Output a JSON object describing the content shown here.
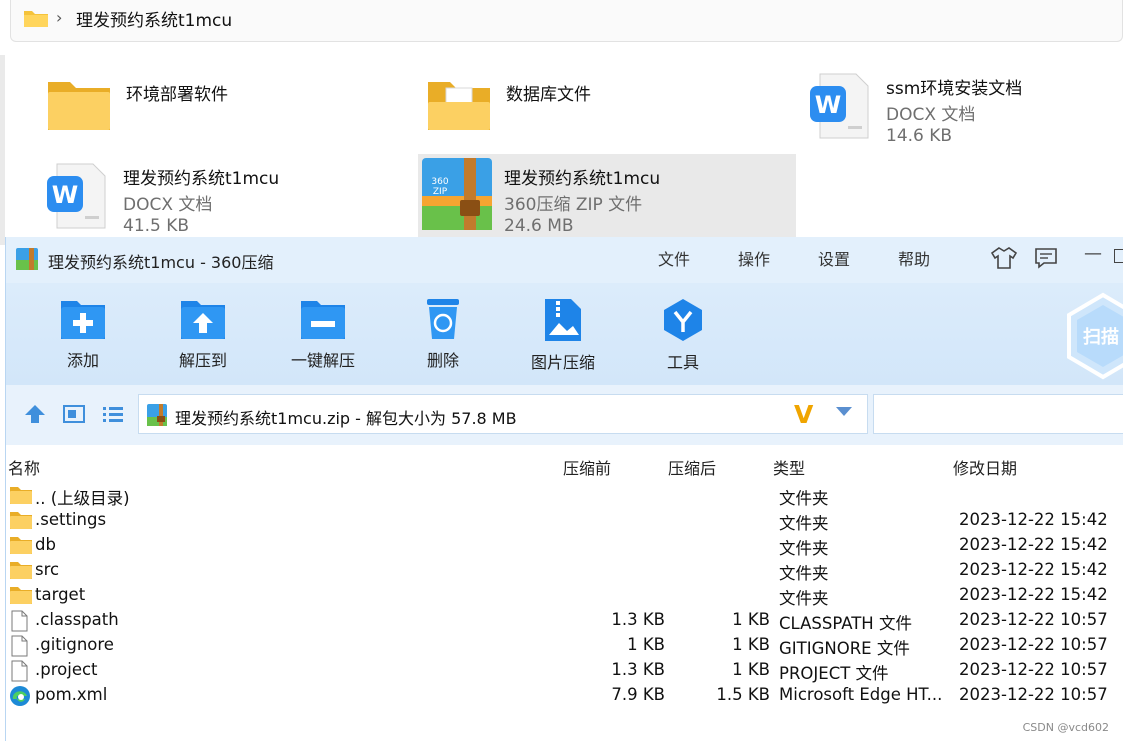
{
  "explorer": {
    "breadcrumb": "理发预约系统t1mcu",
    "items": [
      {
        "name": "环境部署软件",
        "type": "",
        "size": "",
        "icon": "folder-icon"
      },
      {
        "name": "数据库文件",
        "type": "",
        "size": "",
        "icon": "folder-with-document-icon"
      },
      {
        "name": "ssm环境安装文档",
        "type": "DOCX 文档",
        "size": "14.6 KB",
        "icon": "wps-document-icon"
      },
      {
        "name": "理发预约系统t1mcu",
        "type": "DOCX 文档",
        "size": "41.5 KB",
        "icon": "wps-document-icon"
      },
      {
        "name": "理发预约系统t1mcu",
        "type": "360压缩 ZIP 文件",
        "size": "24.6 MB",
        "icon": "zip-archive-icon"
      }
    ]
  },
  "window": {
    "title": "理发预约系统t1mcu - 360压缩",
    "menu": [
      "文件",
      "操作",
      "设置",
      "帮助"
    ],
    "toolbar": [
      "添加",
      "解压到",
      "一键解压",
      "删除",
      "图片压缩",
      "工具"
    ],
    "scan_label": "扫描",
    "address": "理发预约系统t1mcu.zip - 解包大小为 57.8 MB",
    "columns": {
      "name": "名称",
      "before": "压缩前",
      "after": "压缩后",
      "type": "类型",
      "date": "修改日期"
    },
    "rows": [
      {
        "name": ".. (上级目录)",
        "before": "",
        "after": "",
        "type": "文件夹",
        "date": "",
        "icon": "folder-icon"
      },
      {
        "name": ".settings",
        "before": "",
        "after": "",
        "type": "文件夹",
        "date": "2023-12-22 15:42",
        "icon": "folder-icon"
      },
      {
        "name": "db",
        "before": "",
        "after": "",
        "type": "文件夹",
        "date": "2023-12-22 15:42",
        "icon": "folder-icon"
      },
      {
        "name": "src",
        "before": "",
        "after": "",
        "type": "文件夹",
        "date": "2023-12-22 15:42",
        "icon": "folder-icon"
      },
      {
        "name": "target",
        "before": "",
        "after": "",
        "type": "文件夹",
        "date": "2023-12-22 15:42",
        "icon": "folder-icon"
      },
      {
        "name": ".classpath",
        "before": "1.3 KB",
        "after": "1 KB",
        "type": "CLASSPATH 文件",
        "date": "2023-12-22 10:57",
        "icon": "file-icon"
      },
      {
        "name": ".gitignore",
        "before": "1 KB",
        "after": "1 KB",
        "type": "GITIGNORE 文件",
        "date": "2023-12-22 10:57",
        "icon": "file-icon"
      },
      {
        "name": ".project",
        "before": "1.3 KB",
        "after": "1 KB",
        "type": "PROJECT 文件",
        "date": "2023-12-22 10:57",
        "icon": "file-icon"
      },
      {
        "name": "pom.xml",
        "before": "7.9 KB",
        "after": "1.5 KB",
        "type": "Microsoft Edge HT...",
        "date": "2023-12-22 10:57",
        "icon": "edge-icon"
      }
    ]
  },
  "watermark": "CSDN @vcd602",
  "colors": {
    "accent": "#2b8de8",
    "titlebar": "#e3f0fc",
    "toolbar": "#d2e6f9",
    "folder": "#f7c948"
  }
}
